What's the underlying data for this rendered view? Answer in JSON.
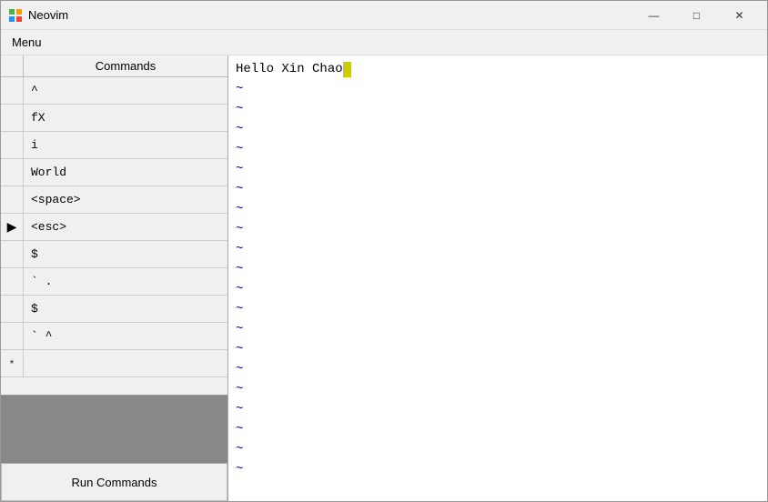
{
  "window": {
    "title": "Neovim",
    "icon": "✦"
  },
  "titlebar_controls": {
    "minimize_label": "—",
    "maximize_label": "□",
    "close_label": "✕"
  },
  "menubar": {
    "menu_label": "Menu"
  },
  "left_panel": {
    "header": "Commands",
    "rows": [
      {
        "marker": "",
        "command": "^"
      },
      {
        "marker": "",
        "command": "fX"
      },
      {
        "marker": "",
        "command": "i"
      },
      {
        "marker": "",
        "command": "World"
      },
      {
        "marker": "",
        "command": "<space>"
      },
      {
        "marker": "▶",
        "command": "<esc>"
      },
      {
        "marker": "",
        "command": "$"
      },
      {
        "marker": "",
        "command": "`.` "
      },
      {
        "marker": "",
        "command": "$"
      },
      {
        "marker": "",
        "command": "`^`"
      },
      {
        "marker": "*",
        "command": ""
      }
    ],
    "run_button_label": "Run Commands"
  },
  "editor": {
    "first_line": "Hello Xin Chao",
    "tildes": [
      "~",
      "~",
      "~",
      "~",
      "~",
      "~",
      "~",
      "~",
      "~",
      "~",
      "~",
      "~",
      "~",
      "~",
      "~",
      "~",
      "~",
      "~"
    ]
  }
}
